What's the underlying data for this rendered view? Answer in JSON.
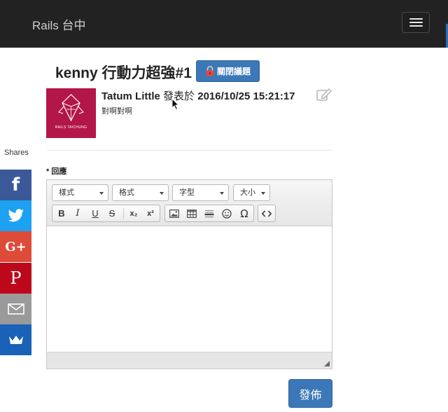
{
  "navbar": {
    "brand": "Rails 台中"
  },
  "topic": {
    "title": "kenny 行動力超強#1",
    "close_button": "關閉議題"
  },
  "post": {
    "author": "Tatum Little",
    "verb": " 發表於 ",
    "timestamp": "2016/10/25 15:21:17",
    "body": "對啊對啊",
    "avatar_text": "RAILS TAICHUNG"
  },
  "shares": {
    "label": "Shares",
    "items": [
      {
        "name": "facebook",
        "glyph": "f",
        "color": "#3b5998"
      },
      {
        "name": "twitter",
        "glyph": "",
        "color": "#1da1f2"
      },
      {
        "name": "google-plus",
        "glyph": "G+",
        "color": "#dd4b39"
      },
      {
        "name": "pinterest",
        "glyph": "P",
        "color": "#bd081c"
      },
      {
        "name": "email",
        "glyph": "",
        "color": "#9a9a9a"
      },
      {
        "name": "crown",
        "glyph": "",
        "color": "#1a62b8"
      }
    ]
  },
  "form": {
    "label_marker": "* ",
    "label": "回應",
    "toolbar": {
      "style_combo": "樣式",
      "format_combo": "格式",
      "font_combo": "字型",
      "size_combo": "大小",
      "bold": "B",
      "italic": "I",
      "underline": "U",
      "strike": "S",
      "subscript": "x₂",
      "superscript": "x²",
      "omega": "Ω"
    },
    "submit": "發佈"
  },
  "colors": {
    "primary": "#3c78b8",
    "navbar": "#222222",
    "avatar": "#b3174a"
  }
}
